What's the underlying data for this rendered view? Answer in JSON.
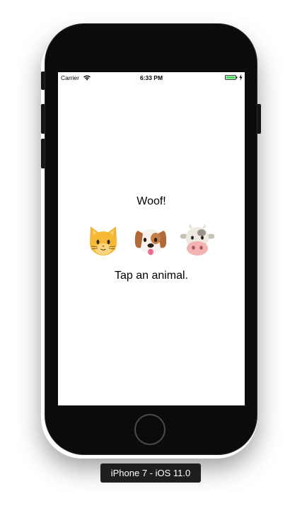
{
  "status_bar": {
    "carrier": "Carrier",
    "time": "6:33 PM",
    "wifi_icon": "wifi-icon",
    "battery_icon": "battery-full-icon",
    "charging_icon": "charging-bolt-icon",
    "battery_color": "#4cd964"
  },
  "app": {
    "sound_text": "Woof!",
    "animals": [
      {
        "name": "cat",
        "icon": "cat-face-icon",
        "emoji": "🐱"
      },
      {
        "name": "dog",
        "icon": "dog-face-icon",
        "emoji": "🐶"
      },
      {
        "name": "cow",
        "icon": "cow-face-icon",
        "emoji": "🐮"
      }
    ],
    "instruction": "Tap an animal."
  },
  "simulator": {
    "device_label": "iPhone 7 - iOS 11.0"
  }
}
